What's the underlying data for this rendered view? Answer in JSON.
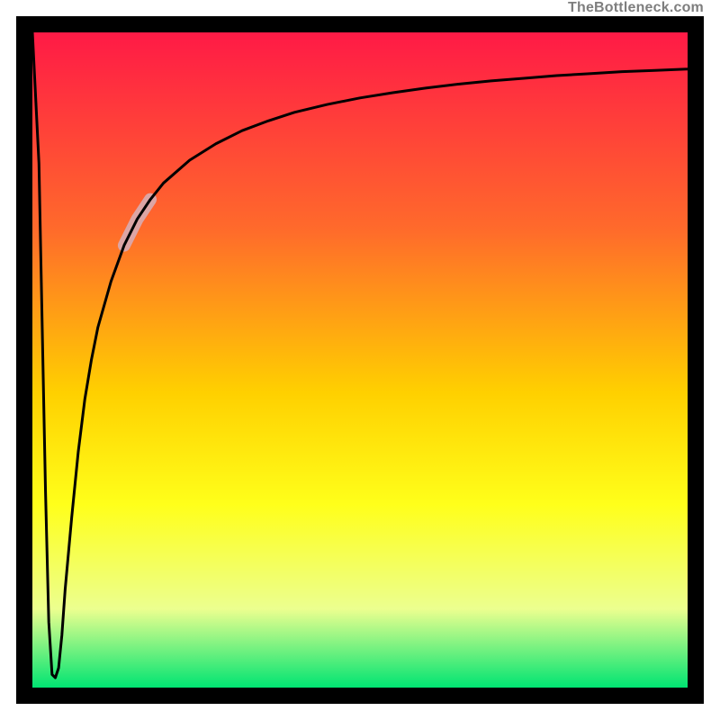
{
  "attribution": "TheBottleneck.com",
  "gradient": {
    "top": "#ff1a46",
    "mid1": "#ff6a2b",
    "mid2": "#ffd000",
    "mid3": "#ffff1a",
    "mid4": "#ecff8f",
    "bottom": "#00e472"
  },
  "chart_data": {
    "type": "line",
    "title": "",
    "xlabel": "",
    "ylabel": "",
    "xlim": [
      0,
      100
    ],
    "ylim": [
      0,
      100
    ],
    "series": [
      {
        "name": "bottleneck-curve",
        "x": [
          0,
          1,
          1.5,
          2,
          2.5,
          3,
          3.5,
          4,
          4.5,
          5,
          6,
          7,
          8,
          9,
          10,
          12,
          14,
          16,
          18,
          20,
          24,
          28,
          32,
          36,
          40,
          45,
          50,
          55,
          60,
          65,
          70,
          75,
          80,
          85,
          90,
          95,
          100
        ],
        "values": [
          100,
          80,
          55,
          30,
          10,
          2,
          1.5,
          3,
          8,
          15,
          26,
          36,
          44,
          50,
          55,
          62,
          67.5,
          71.5,
          74.5,
          77,
          80.5,
          83,
          85,
          86.5,
          87.8,
          89,
          90,
          90.8,
          91.5,
          92.1,
          92.6,
          93,
          93.4,
          93.7,
          94,
          94.2,
          94.4
        ]
      }
    ],
    "highlight": {
      "series": "bottleneck-curve",
      "x_range": [
        14,
        18
      ]
    }
  }
}
